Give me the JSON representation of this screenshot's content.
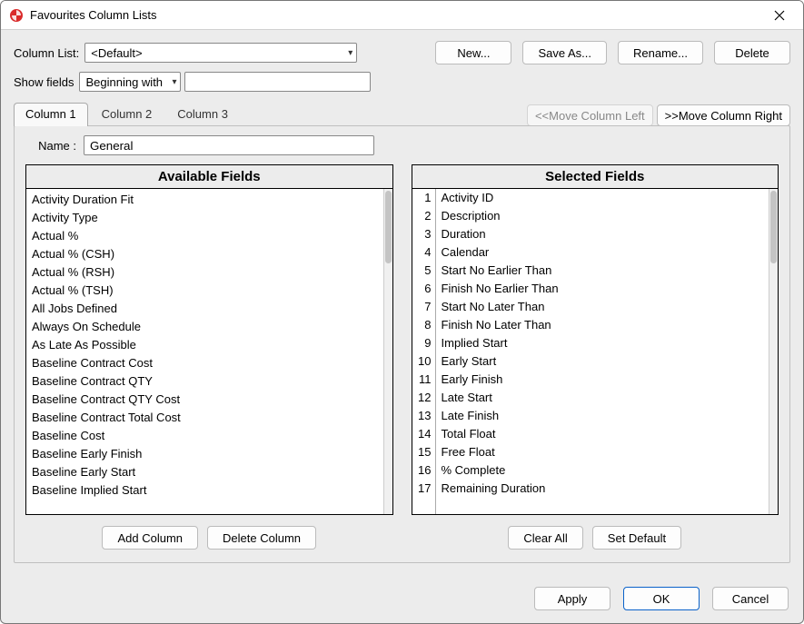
{
  "window": {
    "title": "Favourites Column Lists"
  },
  "columnList": {
    "label": "Column List:",
    "value": "<Default>",
    "buttons": {
      "new": "New...",
      "saveAs": "Save As...",
      "rename": "Rename...",
      "delete": "Delete"
    }
  },
  "showFields": {
    "label": "Show fields",
    "mode": "Beginning with",
    "filter": ""
  },
  "tabs": [
    "Column 1",
    "Column 2",
    "Column 3"
  ],
  "moveButtons": {
    "left": "<<Move Column Left",
    "right": ">>Move Column Right"
  },
  "nameRow": {
    "label": "Name :",
    "value": "General"
  },
  "availableHeader": "Available Fields",
  "selectedHeader": "Selected Fields",
  "available": [
    "Activity Duration Fit",
    "Activity Type",
    "Actual %",
    "Actual % (CSH)",
    "Actual % (RSH)",
    "Actual % (TSH)",
    "All Jobs Defined",
    "Always On Schedule",
    "As Late As Possible",
    "Baseline Contract Cost",
    "Baseline Contract QTY",
    "Baseline Contract QTY Cost",
    "Baseline Contract Total Cost",
    "Baseline Cost",
    "Baseline Early Finish",
    "Baseline Early Start",
    "Baseline Implied Start"
  ],
  "selected": [
    "Activity ID",
    "Description",
    "Duration",
    "Calendar",
    "Start No Earlier Than",
    "Finish No  Earlier Than",
    "Start No Later Than",
    "Finish No Later Than",
    "Implied Start",
    "Early Start",
    "Early Finish",
    "Late Start",
    "Late Finish",
    "Total Float",
    "Free Float",
    "% Complete",
    "Remaining Duration"
  ],
  "belowButtons": {
    "addColumn": "Add Column",
    "deleteColumn": "Delete Column",
    "clearAll": "Clear All",
    "setDefault": "Set Default"
  },
  "bottom": {
    "apply": "Apply",
    "ok": "OK",
    "cancel": "Cancel"
  }
}
